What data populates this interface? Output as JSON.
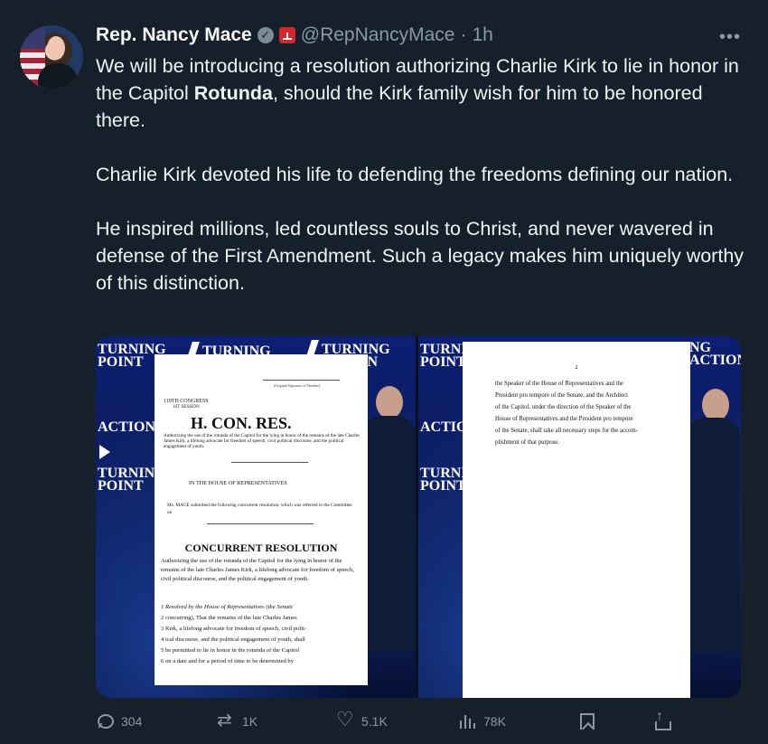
{
  "tweet": {
    "name": "Rep. Nancy Mace",
    "handle": "@RepNancyMace",
    "separator": "·",
    "time": "1h",
    "more": "•••",
    "paragraph1_before": "We will be introducing a resolution authorizing Charlie Kirk to lie in honor in the Capitol ",
    "paragraph1_bold": "Rotunda",
    "paragraph1_after": ", should the Kirk family wish for him to be honored there.",
    "paragraph2": "Charlie Kirk devoted his life to defending the freedoms defining our nation.",
    "paragraph3": "He inspired millions, led countless souls to Christ, and never wavered in defense of the First Amendment. Such a legacy makes him uniquely worthy of this distinction."
  },
  "media": {
    "left": {
      "brand1": "TURNING",
      "brand2": "POINT",
      "brand3": "ACTION",
      "signature": "(Original Signature of Member)",
      "congress": "119TH CONGRESS",
      "session": "1ST SESSION",
      "bill": "H. CON. RES.",
      "summary": "Authorizing the use of the rotunda of the Capitol for the lying in honor of the remains of the late Charles James Kirk, a lifelong advocate for freedom of speech, civil political discourse, and the political engagement of youth.",
      "house": "IN THE HOUSE OF REPRESENTATIVES",
      "sponsor": "Ms. MACE submitted the following concurrent resolution; which was referred to the Committee on",
      "resolution_title": "CONCURRENT RESOLUTION",
      "resolution_summary": "Authorizing the use of the rotunda of the Capitol for the lying in honor of the remains of the late Charles James Kirk, a lifelong advocate for freedom of speech, civil political discourse, and the political engagement of youth.",
      "line1": "1 Resolved by the House of Representatives (the Senate",
      "line2": "2 concurring), That the remains of the late Charles James",
      "line3": "3 Kirk, a lifelong advocate for freedom of speech, civil polit-",
      "line4": "4 ical discourse, and the political engagement of youth, shall",
      "line5": "5 be permitted to lie in honor in the rotunda of the Capitol",
      "line6": "6 on a date and for a period of time to be determined by"
    },
    "right": {
      "page": "2",
      "line1": "the Speaker of the House of Representatives and the",
      "line2": "President pro tempore of the Senate, and the Architect",
      "line3": "of the Capitol, under the direction of the Speaker of the",
      "line4": "House of Representatives and the President pro tempore",
      "line5": "of the Senate, shall take all necessary steps for the accom-",
      "line6": "plishment of that purpose."
    }
  },
  "actions": {
    "replies": "304",
    "reposts": "1K",
    "likes": "5.1K",
    "views": "78K"
  },
  "colors": {
    "background": "#15202b",
    "text": "#e7e9ea",
    "muted": "#8b98a5",
    "media_blue": "#0d1f73"
  }
}
